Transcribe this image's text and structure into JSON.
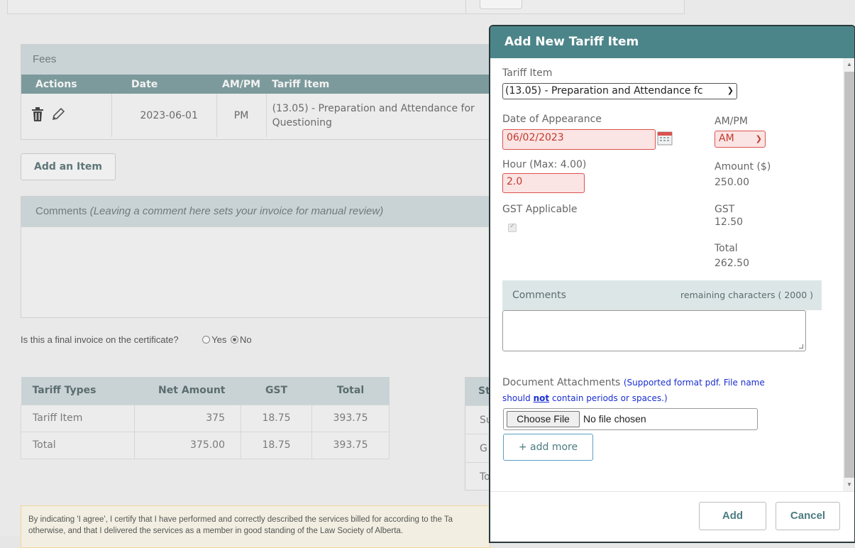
{
  "fees": {
    "title": "Fees",
    "columns": [
      "Actions",
      "Date",
      "AM/PM",
      "Tariff Item"
    ],
    "rows": [
      {
        "date": "2023-06-01",
        "ampm": "PM",
        "tariff_line1": "(13.05) - Preparation and Attendance for",
        "tariff_line2": "Questioning"
      }
    ]
  },
  "add_item_label": "Add an Item",
  "comments": {
    "label": "Comments",
    "note": "(Leaving a comment here sets your invoice for manual review)"
  },
  "final_invoice": {
    "question": "Is this a final invoice on the certificate?",
    "yes": "Yes",
    "no": "No",
    "selected": "No"
  },
  "tariff_summary": {
    "columns": [
      "Tariff Types",
      "Net Amount",
      "GST",
      "Total"
    ],
    "rows": [
      {
        "type": "Tariff Item",
        "net": "375",
        "gst": "18.75",
        "total": "393.75"
      },
      {
        "type": "Total",
        "net": "375.00",
        "gst": "18.75",
        "total": "393.75"
      }
    ]
  },
  "side_summary": {
    "header": "St",
    "rows": [
      "Su",
      "G",
      "To"
    ]
  },
  "agreement": {
    "line1": "By indicating 'I agree', I certify that I have performed and correctly described the services billed for according to the Ta",
    "line2": "otherwise, and that I delivered the services as a member in good standing of the Law Society of Alberta."
  },
  "modal": {
    "title": "Add New Tariff Item",
    "tariff_item_label": "Tariff Item",
    "tariff_item_value": "(13.05) - Preparation and Attendance fc",
    "date_label": "Date of Appearance",
    "date_value": "06/02/2023",
    "ampm_label": "AM/PM",
    "ampm_value": "AM",
    "hour_label": "Hour (Max: 4.00)",
    "hour_value": "2.0",
    "amount_label": "Amount ($)",
    "amount_value": "250.00",
    "gst_applicable_label": "GST Applicable",
    "gst_label": "GST",
    "gst_value": "12.50",
    "total_label": "Total",
    "total_value": "262.50",
    "comments_label": "Comments",
    "remaining_label": "remaining characters ( 2000 )",
    "doc_label": "Document Attachments",
    "doc_note_1": "(Supported format pdf. File name",
    "doc_note_2": "should",
    "doc_note_not": "not",
    "doc_note_3": "contain periods or spaces.)",
    "choose_file": "Choose File",
    "no_file": "No file chosen",
    "add_more": "+ add more",
    "add_button": "Add",
    "cancel_button": "Cancel"
  },
  "colors": {
    "modal_header": "#4c8589",
    "table_header": "#7c9a9c",
    "panel_header": "#c9d3d5",
    "error_border": "#d9534f"
  }
}
